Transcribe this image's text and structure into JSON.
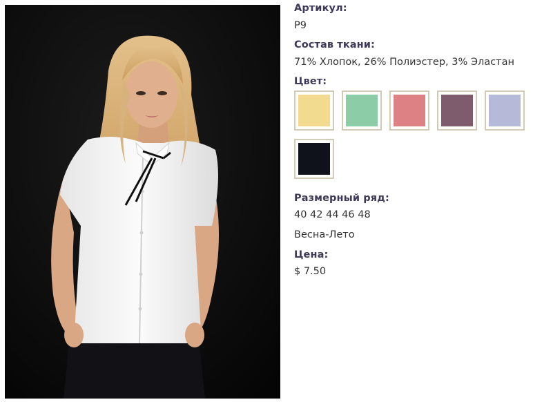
{
  "product": {
    "article": {
      "label": "Артикул:",
      "value": "P9"
    },
    "fabric": {
      "label": "Состав ткани:",
      "value": "71% Хлопок, 26% Полиэстер, 3% Эластан"
    },
    "colors": {
      "label": "Цвет:",
      "swatches": [
        {
          "name": "yellow",
          "color": "#f2db8f"
        },
        {
          "name": "mint",
          "color": "#8ccca6"
        },
        {
          "name": "pink",
          "color": "#de8185"
        },
        {
          "name": "plum",
          "color": "#7e5b6d"
        },
        {
          "name": "lavender",
          "color": "#b6bad8"
        },
        {
          "name": "black",
          "color": "#10121b"
        }
      ]
    },
    "sizes": {
      "label": "Размерный ряд:",
      "value": "40 42 44 46 48"
    },
    "season": "Весна-Лето",
    "price": {
      "label": "Цена:",
      "value": "$ 7.50"
    }
  },
  "colors": {
    "label": "#3d3957",
    "text": "#333333",
    "swatch_border": "#d4cbb7"
  }
}
